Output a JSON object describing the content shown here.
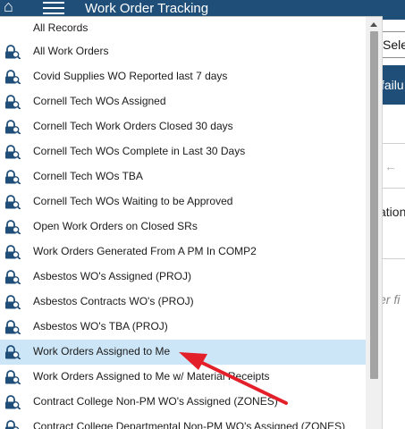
{
  "app": {
    "title": "Work Order Tracking",
    "home_icon": "home-icon",
    "menu_icon": "hamburger-menu-icon",
    "select_partial": "Sele",
    "button_partial": "failu",
    "back_icon": "back-arrow-icon",
    "label_partial": "ation",
    "hint_partial": "er fi"
  },
  "dropdown": {
    "items": [
      {
        "label": "All Records",
        "icon": ""
      },
      {
        "label": "All Work Orders",
        "icon": "lock-search-icon"
      },
      {
        "label": "Covid Supplies WO Reported last 7 days",
        "icon": "lock-search-icon"
      },
      {
        "label": "Cornell Tech WOs Assigned",
        "icon": "lock-search-icon"
      },
      {
        "label": "Cornell Tech Work Orders Closed 30 days",
        "icon": "lock-search-icon"
      },
      {
        "label": "Cornell Tech WOs Complete in Last 30 Days",
        "icon": "lock-search-icon"
      },
      {
        "label": "Cornell Tech WOs TBA",
        "icon": "lock-search-icon"
      },
      {
        "label": "Cornell Tech WOs Waiting to be Approved",
        "icon": "lock-search-icon"
      },
      {
        "label": "Open Work Orders on Closed SRs",
        "icon": "lock-search-icon"
      },
      {
        "label": "Work Orders Generated From A PM In COMP2",
        "icon": "lock-search-icon"
      },
      {
        "label": "Asbestos WO's Assigned (PROJ)",
        "icon": "lock-search-icon"
      },
      {
        "label": "Asbestos Contracts WO's (PROJ)",
        "icon": "lock-search-icon"
      },
      {
        "label": "Asbestos WO's TBA (PROJ)",
        "icon": "lock-search-icon"
      },
      {
        "label": "Work Orders Assigned to Me",
        "icon": "lock-search-icon"
      },
      {
        "label": "Work Orders Assigned to Me w/ Material Receipts",
        "icon": "lock-search-icon"
      },
      {
        "label": "Contract College Non-PM WO's Assigned (ZONES)",
        "icon": "lock-search-icon"
      },
      {
        "label": "Contract College Departmental Non-PM WO's Assigned (ZONES)",
        "icon": "lock-search-icon"
      }
    ],
    "selected_index": 13
  },
  "colors": {
    "header_bg": "#1f4e78",
    "selected_bg": "#cde6f7",
    "icon_color": "#1f4e78",
    "annotation_arrow": "#e3202a"
  }
}
